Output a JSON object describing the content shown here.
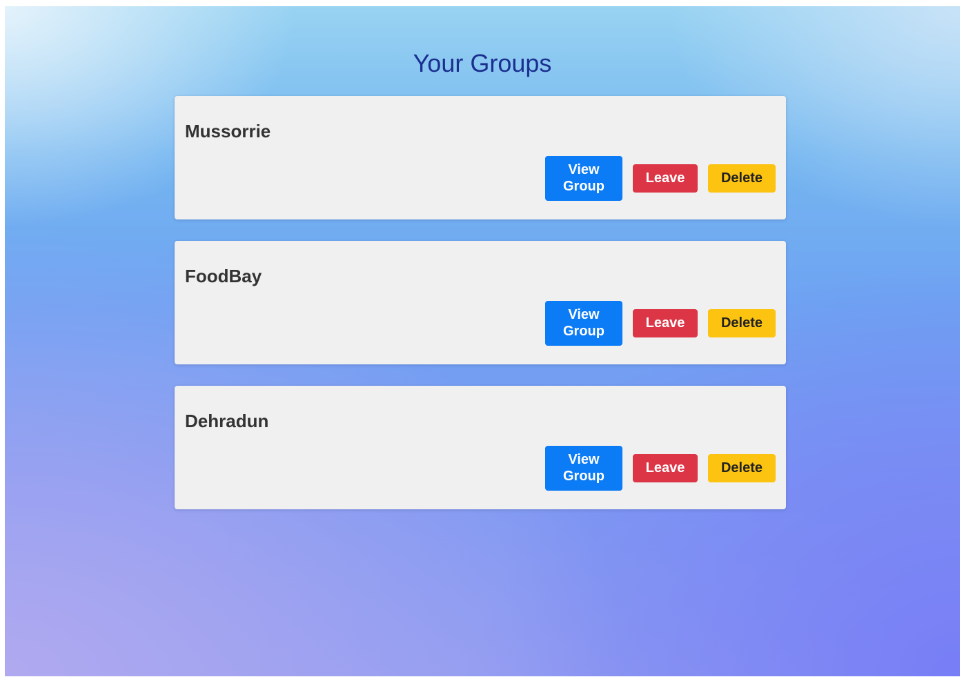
{
  "page": {
    "title": "Your Groups"
  },
  "groups": [
    {
      "name": "Mussorrie",
      "view_label": "View\nGroup",
      "leave_label": "Leave",
      "delete_label": "Delete"
    },
    {
      "name": "FoodBay",
      "view_label": "View\nGroup",
      "leave_label": "Leave",
      "delete_label": "Delete"
    },
    {
      "name": "Dehradun",
      "view_label": "View\nGroup",
      "leave_label": "Leave",
      "delete_label": "Delete"
    }
  ],
  "colors": {
    "title": "#1b2f8f",
    "view_button": "#0b7bf6",
    "leave_button": "#dc3545",
    "delete_button": "#fdc311",
    "card": "#f0f0f0"
  }
}
